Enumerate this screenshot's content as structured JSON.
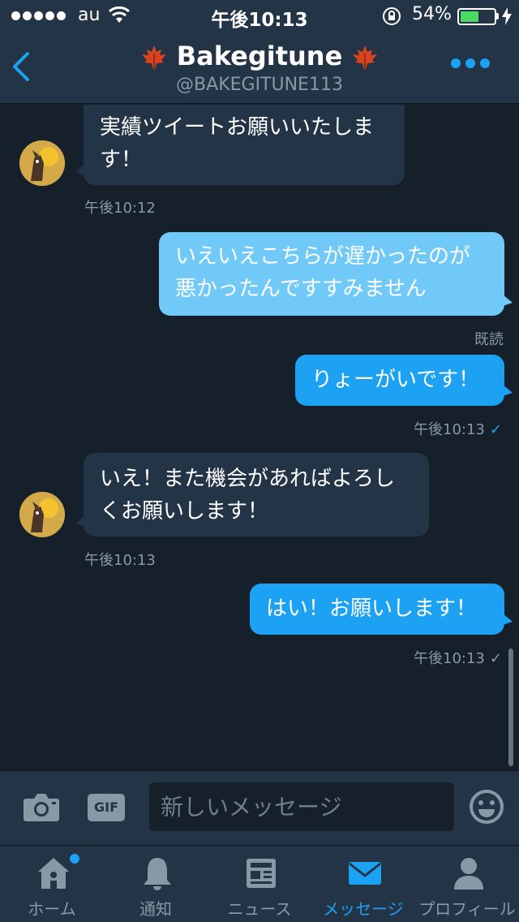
{
  "status_bar": {
    "carrier": "au",
    "time": "午後10:13",
    "battery_percent": "54%",
    "battery_level": 0.54
  },
  "header": {
    "title": "Bakegitune",
    "handle": "@BAKEGITUNE113"
  },
  "messages": [
    {
      "direction": "in",
      "text_lines": [
        "実績ツイートお願いいたしま",
        "す！"
      ],
      "time": "午後10:12"
    },
    {
      "direction": "out",
      "text_lines": [
        "いえいえこちらが遅かったのが",
        "悪かったんですすみません"
      ],
      "status": "既読"
    },
    {
      "direction": "out",
      "text_lines": [
        "りょーがいです！"
      ],
      "time": "午後10:13",
      "check": "✓"
    },
    {
      "direction": "in",
      "text_lines": [
        "いえ！また機会があればよろし",
        "くお願いします！"
      ],
      "time": "午後10:13"
    },
    {
      "direction": "out",
      "text_lines": [
        "はい！お願いします！"
      ],
      "time": "午後10:13",
      "check": "✓"
    }
  ],
  "compose": {
    "gif_label": "GIF",
    "placeholder": "新しいメッセージ"
  },
  "tabs": [
    {
      "label": "ホーム",
      "icon": "home-icon",
      "active": false,
      "badge": true
    },
    {
      "label": "通知",
      "icon": "bell-icon",
      "active": false
    },
    {
      "label": "ニュース",
      "icon": "news-icon",
      "active": false
    },
    {
      "label": "メッセージ",
      "icon": "envelope-icon",
      "active": true
    },
    {
      "label": "プロフィール",
      "icon": "person-icon",
      "active": false
    }
  ],
  "colors": {
    "background": "#15202b",
    "bar": "#243447",
    "accent": "#1da1f2",
    "muted": "#8899a6",
    "battery": "#4cd964"
  }
}
